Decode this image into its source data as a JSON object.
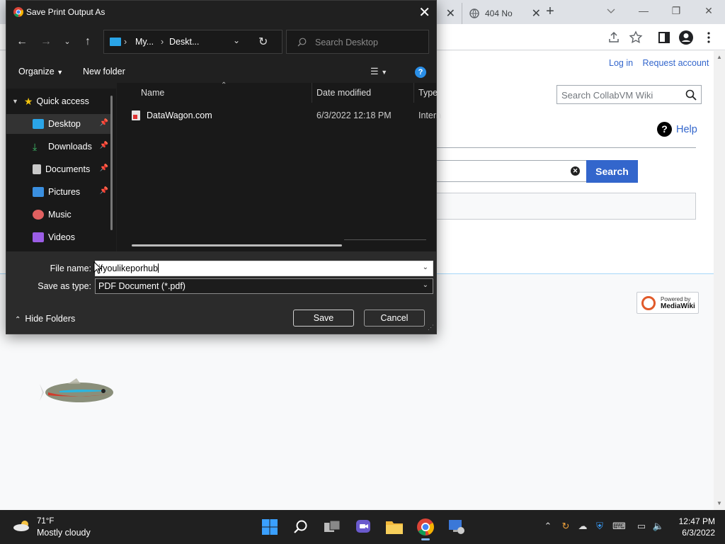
{
  "browser": {
    "tab_partial_label": "404 No",
    "close_glyph": "✕",
    "new_tab_glyph": "+"
  },
  "wiki": {
    "login": "Log in",
    "request_account": "Request account",
    "search_placeholder": "Search CollabVM Wiki",
    "help_label": "Help",
    "search_button": "Search",
    "powered_line1": "Powered by",
    "powered_line2": "MediaWiki"
  },
  "dialog": {
    "title": "Save Print Output As",
    "address_crumbs": [
      "My...",
      "Deskt..."
    ],
    "search_placeholder": "Search Desktop",
    "organize_label": "Organize",
    "new_folder_label": "New folder",
    "nav_items": [
      {
        "label": "Quick access",
        "icon": "star-icon",
        "color": "#f2c40e"
      },
      {
        "label": "Desktop",
        "icon": "desktop-icon",
        "color": "#2aa5e8",
        "pinned": true,
        "selected": true
      },
      {
        "label": "Downloads",
        "icon": "download-icon",
        "color": "#3fbf6a",
        "pinned": true
      },
      {
        "label": "Documents",
        "icon": "documents-icon",
        "color": "#c9c9c9",
        "pinned": true
      },
      {
        "label": "Pictures",
        "icon": "pictures-icon",
        "color": "#3a8fe0",
        "pinned": true
      },
      {
        "label": "Music",
        "icon": "music-icon",
        "color": "#e06060"
      },
      {
        "label": "Videos",
        "icon": "videos-icon",
        "color": "#9b5de5"
      }
    ],
    "columns": {
      "name": "Name",
      "date": "Date modified",
      "type": "Type"
    },
    "files": [
      {
        "name": "DataWagon.com",
        "date": "6/3/2022 12:18 PM",
        "type": "Intern"
      }
    ],
    "file_name_label": "File name:",
    "file_name_value": "ifyoulikeporhub",
    "save_type_label": "Save as type:",
    "save_type_value": "PDF Document (*.pdf)",
    "hide_folders_label": "Hide Folders",
    "save_label": "Save",
    "cancel_label": "Cancel"
  },
  "taskbar": {
    "temperature": "71°F",
    "condition": "Mostly cloudy",
    "time": "12:47 PM",
    "date": "6/3/2022"
  },
  "colors": {
    "dialog_bg": "#202020",
    "accent_blue": "#3366cc",
    "taskbar_bg": "#202020"
  }
}
